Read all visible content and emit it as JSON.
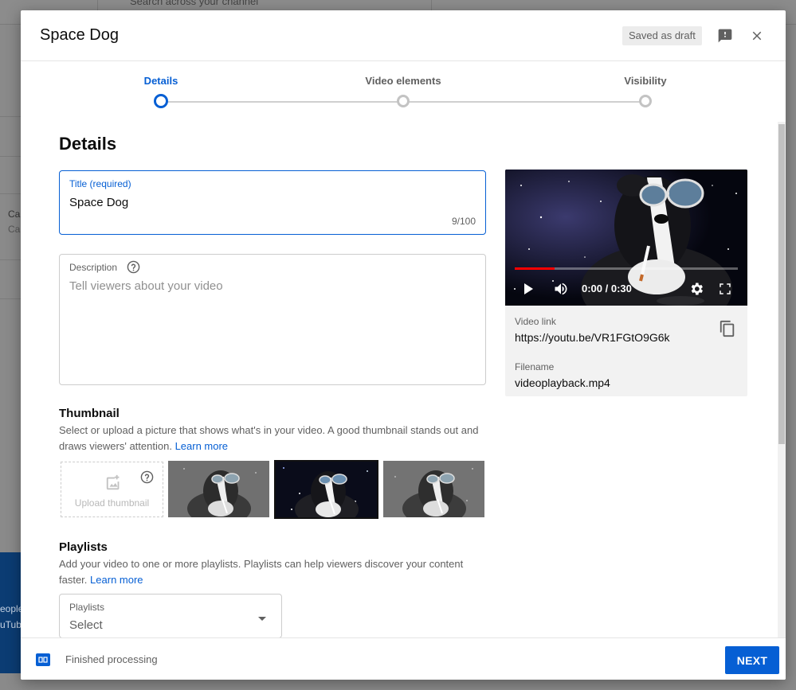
{
  "background": {
    "search_placeholder": "Search across your channel",
    "left_texts": [
      "Ca",
      "Ca"
    ],
    "blue_texts": [
      "eople",
      "uTub"
    ]
  },
  "modal": {
    "title": "Space Dog",
    "draft_label": "Saved as draft",
    "feedback_icon": "feedback-icon",
    "close_icon": "close-icon"
  },
  "stepper": {
    "steps": [
      {
        "label": "Details",
        "state": "active"
      },
      {
        "label": "Video elements",
        "state": "pending"
      },
      {
        "label": "Visibility",
        "state": "pending"
      }
    ]
  },
  "details": {
    "heading": "Details",
    "title_field": {
      "label": "Title (required)",
      "value": "Space Dog",
      "counter": "9/100"
    },
    "description_field": {
      "label": "Description",
      "placeholder": "Tell viewers about your video"
    }
  },
  "thumbnail": {
    "heading": "Thumbnail",
    "description": "Select or upload a picture that shows what's in your video. A good thumbnail stands out and draws viewers' attention.",
    "learn_more": "Learn more",
    "upload_label": "Upload thumbnail",
    "options": [
      {
        "variant": "gray-tint",
        "selected": false
      },
      {
        "variant": "dark-space",
        "selected": true
      },
      {
        "variant": "gray-tint",
        "selected": false
      }
    ]
  },
  "playlists": {
    "heading": "Playlists",
    "description": "Add your video to one or more playlists. Playlists can help viewers discover your content faster.",
    "learn_more": "Learn more",
    "select_label": "Playlists",
    "select_value": "Select"
  },
  "video": {
    "time": "0:00 / 0:30",
    "progress": 0.18,
    "link_label": "Video link",
    "link": "https://youtu.be/VR1FGtO9G6k",
    "filename_label": "Filename",
    "filename": "videoplayback.mp4"
  },
  "footer": {
    "status": "Finished processing",
    "next_label": "NEXT"
  },
  "colors": {
    "accent": "#065fd4",
    "progress": "#ff0000",
    "text_secondary": "#606060"
  }
}
